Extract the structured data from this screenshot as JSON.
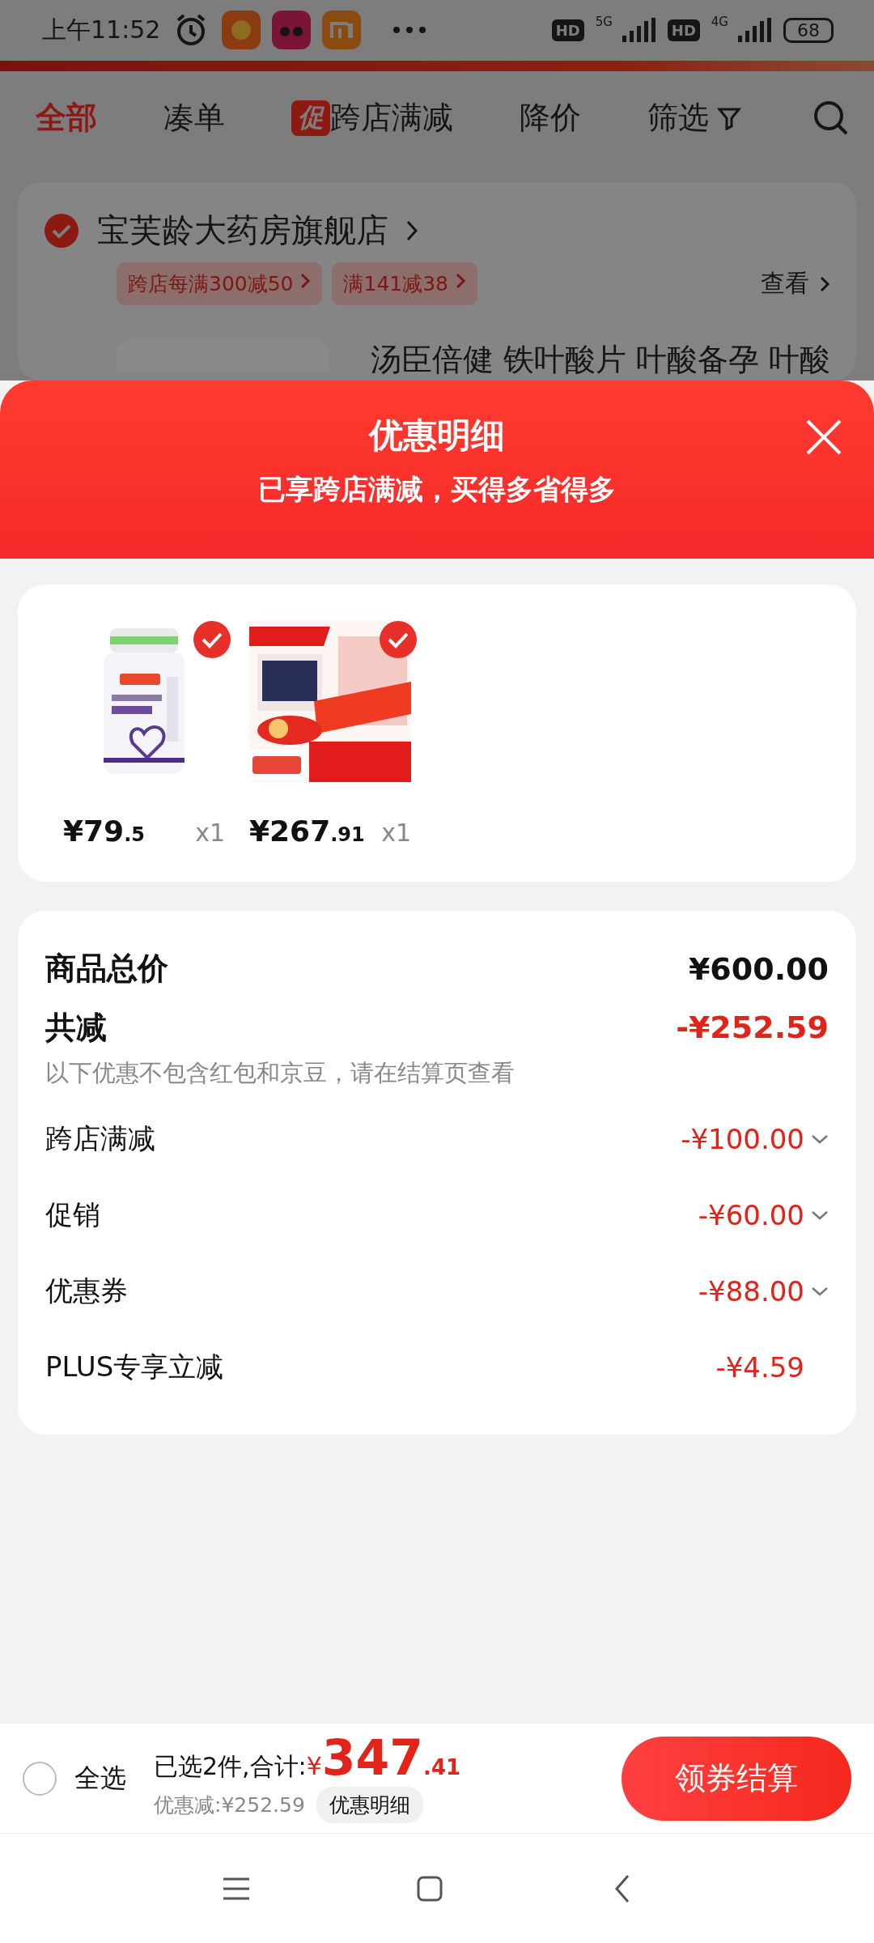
{
  "status_bar": {
    "time": "上午11:52",
    "network_badges": [
      "HD",
      "HD"
    ],
    "network_types": [
      "5G",
      "4G"
    ],
    "battery": "68"
  },
  "tabs": [
    {
      "label": "全部",
      "selected": true
    },
    {
      "label": "凑单",
      "selected": false
    },
    {
      "label": "跨店满减",
      "selected": false,
      "badge": "促"
    },
    {
      "label": "降价",
      "selected": false
    },
    {
      "label": "筛选",
      "selected": false,
      "kind": "filter"
    }
  ],
  "store": {
    "name": "宝芙龄大药房旗舰店",
    "checked": true,
    "promos": [
      "跨店每满300减50",
      "满141减38"
    ],
    "view_label": "查看",
    "product_title": "汤臣倍健 铁叶酸片 叶酸备孕 叶酸"
  },
  "sheet": {
    "title": "优惠明细",
    "subtitle": "已享跨店满减，买得多省得多"
  },
  "items": [
    {
      "kind": "picture",
      "price": "¥79",
      "price_decimal": ".5",
      "quantity": "x1",
      "checked": true
    },
    {
      "kind": "picture",
      "price": "¥267",
      "price_decimal": ".91",
      "quantity": "x1",
      "checked": true
    }
  ],
  "summary": {
    "total_label": "商品总价",
    "total_value": "¥600.00",
    "discount_label": "共减",
    "discount_value": "-¥252.59",
    "note": "以下优惠不包含红包和京豆，请在结算页查看",
    "rows": [
      {
        "label": "跨店满减",
        "value": "-¥100.00",
        "expandable": true
      },
      {
        "label": "促销",
        "value": "-¥60.00",
        "expandable": true
      },
      {
        "label": "优惠券",
        "value": "-¥88.00",
        "expandable": true
      },
      {
        "label": "PLUS专享立减",
        "value": "-¥4.59",
        "expandable": false
      }
    ]
  },
  "bottom_bar": {
    "select_all_label": "全选",
    "select_all_checked": false,
    "selected_text": "已选2件,合计:",
    "currency": "¥",
    "amount": "347",
    "amount_decimal": ".41",
    "saved_text": "优惠减:¥252.59",
    "detail_button": "优惠明细",
    "checkout_button": "领券结算"
  }
}
